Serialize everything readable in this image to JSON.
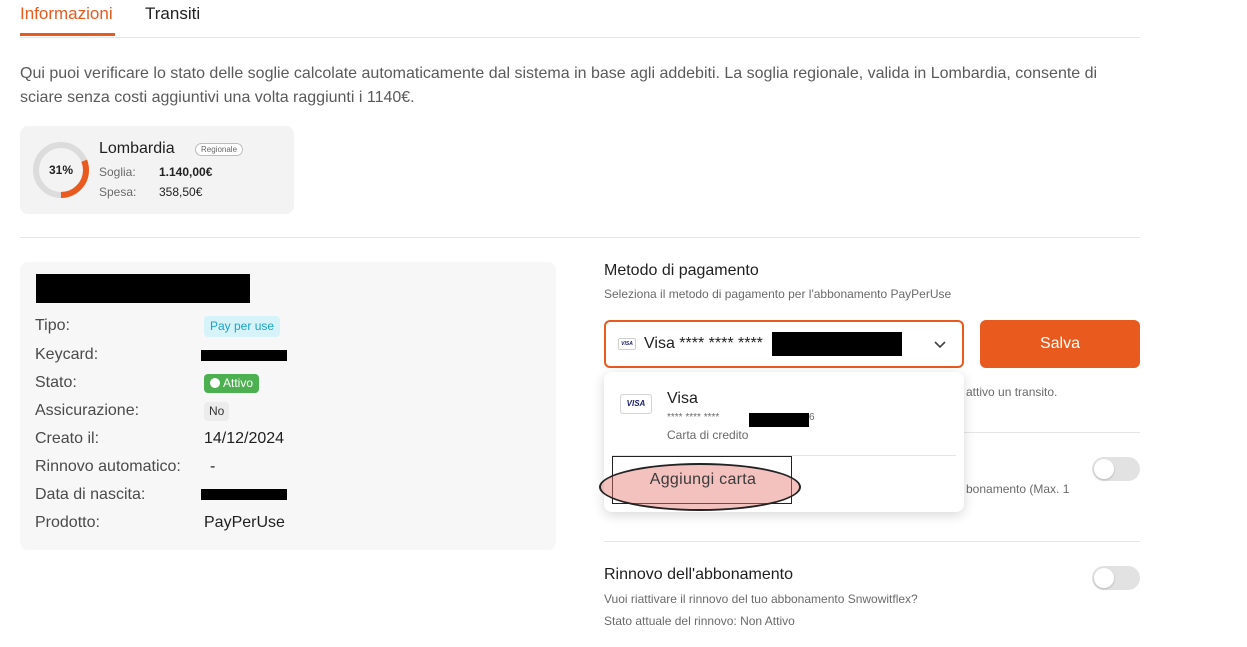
{
  "tabs": [
    {
      "label": "Informazioni",
      "active": true
    },
    {
      "label": "Transiti",
      "active": false
    }
  ],
  "intro": "Qui puoi verificare lo stato delle soglie calcolate automaticamente dal sistema in base agli addebiti. La soglia regionale, valida in Lombardia, consente di sciare senza costi aggiuntivi una volta raggiunti i 1140€.",
  "threshold": {
    "percent_label": "31%",
    "percent": 31,
    "region": "Lombardia",
    "badge": "Regionale",
    "soglia_label": "Soglia:",
    "soglia_value": "1.140,00€",
    "spesa_label": "Spesa:",
    "spesa_value": "358,50€"
  },
  "subscription": {
    "rows": [
      {
        "label": "Tipo:",
        "value": "Pay per use"
      },
      {
        "label": "Keycard:",
        "value": ""
      },
      {
        "label": "Stato:",
        "value": "Attivo"
      },
      {
        "label": "Assicurazione:",
        "value": "No"
      },
      {
        "label": "Creato il:",
        "value": "14/12/2024"
      },
      {
        "label": "Rinnovo automatico:",
        "value": "-"
      },
      {
        "label": "Data di nascita:",
        "value": ""
      },
      {
        "label": "Prodotto:",
        "value": "PayPerUse"
      }
    ]
  },
  "payment": {
    "title": "Metodo di pagamento",
    "subtitle": "Seleziona il metodo di pagamento per l'abbonamento PayPerUse",
    "selected": "Visa **** **** ****",
    "save_label": "Salva",
    "partial_text_1": "attivo un transito.",
    "partial_text_2": "bonamento (Max. 1",
    "dropdown": {
      "option_name": "Visa",
      "option_number": "**** **** ****",
      "option_suffix": "6",
      "option_type": "Carta di credito",
      "add_label": "Aggiungi carta"
    }
  },
  "renewal": {
    "title": "Rinnovo dell'abbonamento",
    "question": "Vuoi riattivare il rinnovo del tuo abbonamento Snwowitflex?",
    "status": "Stato attuale del rinnovo: Non Attivo"
  },
  "colors": {
    "accent": "#e85a1e",
    "active": "#4caf50",
    "info": "#1ba3c6"
  },
  "icons": [
    "visa-card-icon",
    "chevron-down-icon",
    "status-dot-icon"
  ]
}
